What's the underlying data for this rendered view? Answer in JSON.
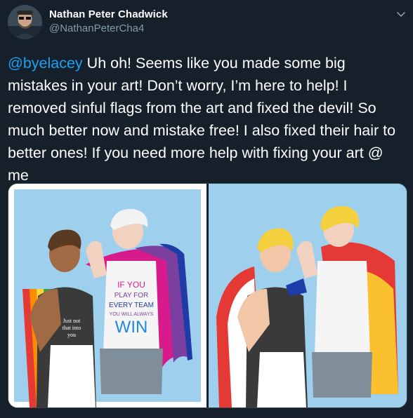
{
  "tweet": {
    "author_name": "Nathan Peter Chadwick",
    "author_handle": "@NathanPeterCha4",
    "mention": "@byelacey",
    "body": " Uh oh! Seems like you made some big mistakes in your art! Don’t worry, I’m here to help! I removed sinful flags from the art and fixed the devil! So much better now and mistake free! I also fixed their hair to better ones! If you need more help with fixing your art @ me"
  },
  "media": {
    "left_image": {
      "shirt_lines": [
        "IF YOU",
        "PLAY FOR",
        "EVERY TEAM",
        "YOU WILL ALWAYS",
        "WIN"
      ],
      "tank_lines": [
        "Just not",
        "that into",
        "you"
      ]
    }
  },
  "icons": {
    "menu": "chevron-down-icon",
    "avatar": "user-avatar"
  },
  "colors": {
    "background": "#15202b",
    "text": "#ffffff",
    "secondary_text": "#8899a6",
    "link": "#1da1f2",
    "border": "#38444d"
  }
}
